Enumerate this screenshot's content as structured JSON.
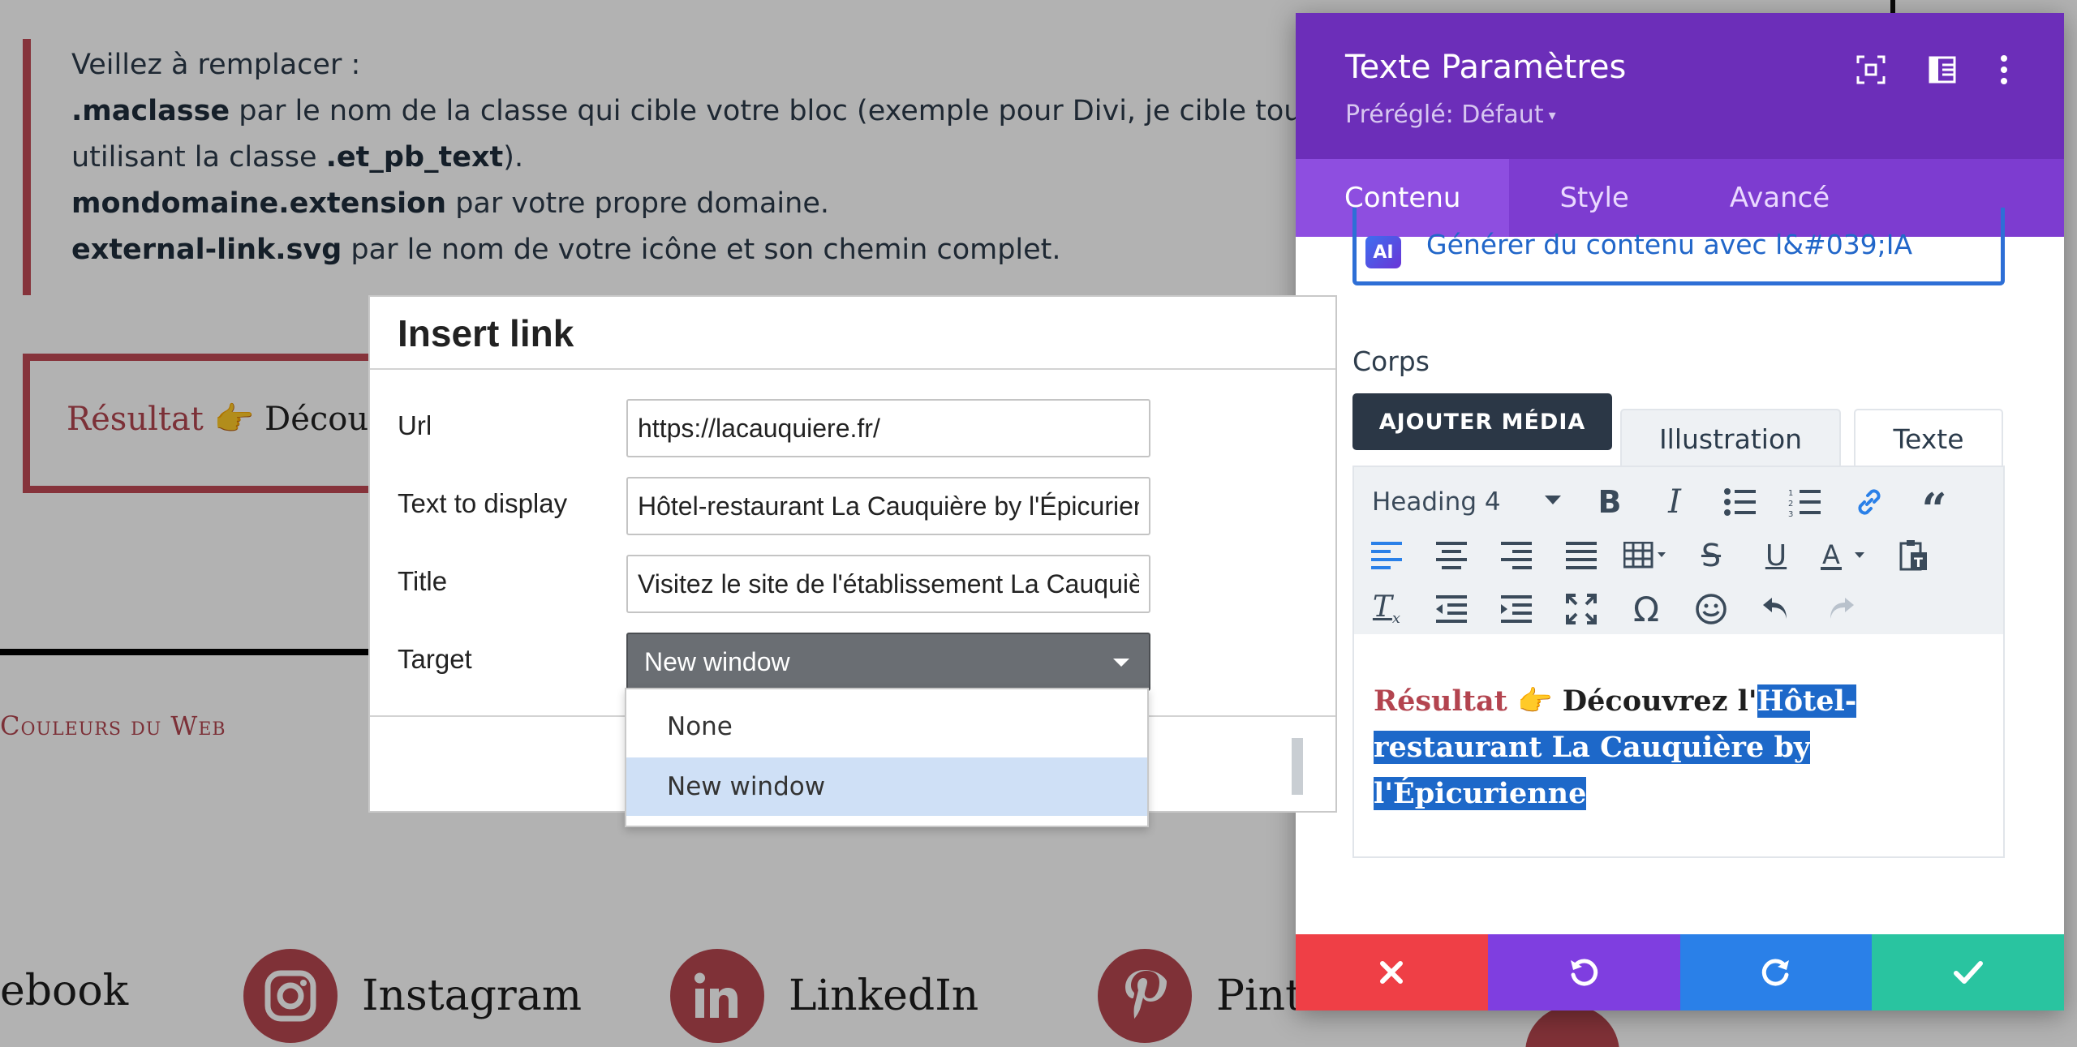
{
  "article": {
    "quote_lines": [
      {
        "plain_before": "Veillez à remplacer :",
        "bold": "",
        "plain_after": ""
      },
      {
        "plain_before": "",
        "bold": ".maclasse",
        "plain_after": " par le nom de la classe qui cible votre bloc (exemple pour Divi, je cible tous"
      },
      {
        "plain_before": "utilisant la classe ",
        "bold": ".et_pb_text",
        "plain_after": ")."
      },
      {
        "plain_before": "",
        "bold": "mondomaine.extension",
        "plain_after": " par votre propre domaine."
      },
      {
        "plain_before": "",
        "bold": "external-link.svg",
        "plain_after": " par le nom de votre icône et son chemin complet."
      }
    ],
    "result_label": "Résultat",
    "result_emoji": "👉",
    "result_text": "Découv",
    "brand": "Couleurs du Web",
    "social": {
      "facebook": "ebook",
      "instagram": "Instagram",
      "linkedin": "LinkedIn",
      "pinterest": "Pint"
    }
  },
  "panel": {
    "title": "Texte Paramètres",
    "preset": "Préréglé: Défaut",
    "tabs": [
      "Contenu",
      "Style",
      "Avancé"
    ],
    "active_tab": "Contenu",
    "ai_badge": "AI",
    "ai_button": "Générer du contenu avec l&#039;IA",
    "section_label": "Corps",
    "add_media": "AJOUTER MÉDIA",
    "editor_tabs": {
      "visual": "Illustration",
      "text": "Texte"
    },
    "heading_select": "Heading 4",
    "editor_content": {
      "red": "Résultat",
      "emoji": "👉",
      "plain": "Découvrez l'",
      "selected": "Hôtel-restaurant La Cauquière by l'Épicurienne"
    }
  },
  "dialog": {
    "title": "Insert link",
    "fields": {
      "url": {
        "label": "Url",
        "value": "https://lacauquiere.fr/"
      },
      "text": {
        "label": "Text to display",
        "value": "Hôtel-restaurant La Cauquière by l'Épicurienne"
      },
      "title": {
        "label": "Title",
        "value": "Visitez le site de l'établissement La Cauquière situé au B"
      },
      "target": {
        "label": "Target",
        "value": "New window"
      }
    },
    "target_options": [
      "None",
      "New window"
    ],
    "target_selected": "New window"
  },
  "colors": {
    "purple_header": "#6c2eb9",
    "purple_tabs": "#7d3cd0",
    "brand_red": "#b6474f",
    "cancel": "#ef3f46",
    "undo": "#7f3ee0",
    "redo": "#2a80e8",
    "save": "#29c4a0",
    "selection_blue": "#1d68c9"
  }
}
